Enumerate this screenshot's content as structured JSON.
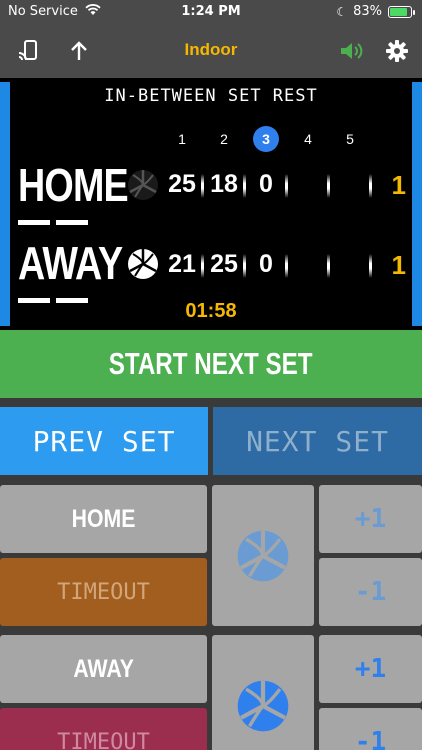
{
  "status": {
    "carrier": "No Service",
    "time": "1:24 PM",
    "battery": "83%"
  },
  "toolbar": {
    "title": "Indoor"
  },
  "scoreboard": {
    "caption": "IN-BETWEEN SET REST",
    "sets": [
      "1",
      "2",
      "3",
      "4",
      "5"
    ],
    "current_set": 3,
    "home": {
      "name": "HOME",
      "scores": [
        "25",
        "18",
        "0",
        "",
        ""
      ],
      "sets_won": "1"
    },
    "away": {
      "name": "AWAY",
      "scores": [
        "21",
        "25",
        "0",
        "",
        ""
      ],
      "sets_won": "1"
    },
    "timer": "01:58"
  },
  "actions": {
    "start_next_set": "START NEXT SET",
    "prev_set": "PREV SET",
    "next_set": "NEXT SET"
  },
  "controls": {
    "home_label": "HOME",
    "away_label": "AWAY",
    "timeout_label": "TIMEOUT",
    "plus": "+1",
    "minus": "-1"
  },
  "colors": {
    "accent": "#f5b800",
    "blue": "#2f80ed",
    "green": "#4caf50"
  },
  "icons": [
    "cast-icon",
    "share-icon",
    "speaker-icon",
    "gear-icon",
    "volleyball-icon"
  ]
}
